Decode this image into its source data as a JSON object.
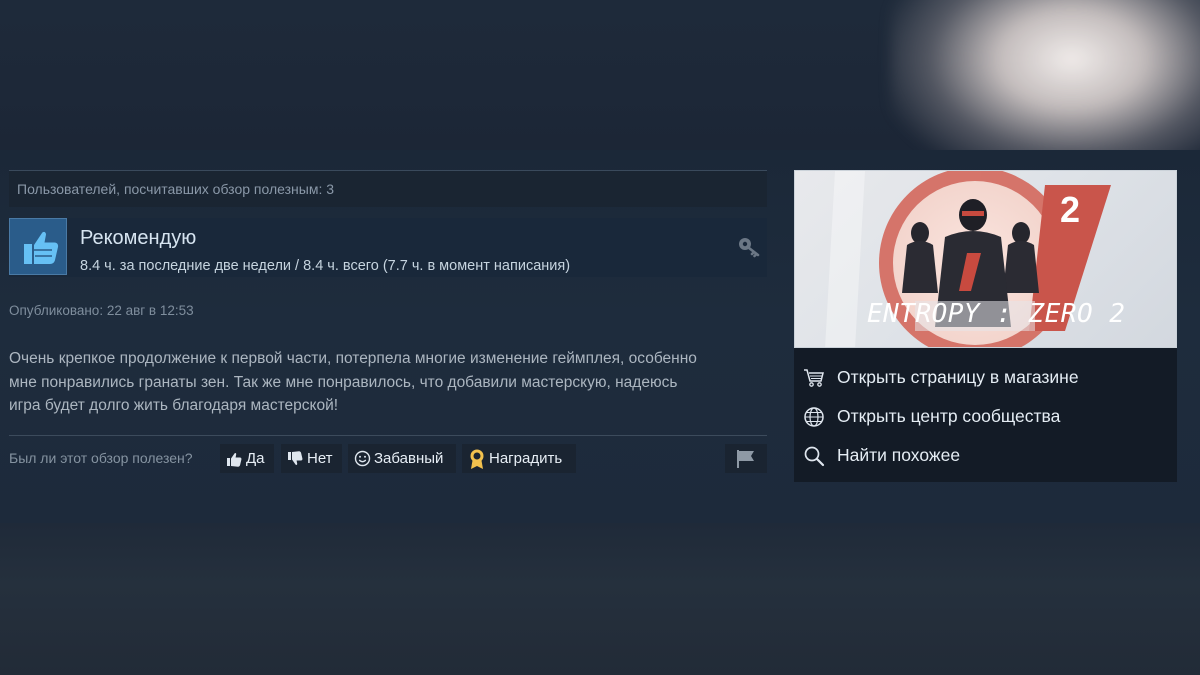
{
  "review": {
    "helpful_count_text": "Пользователей, посчитавших обзор полезным: 3",
    "verdict": "Рекомендую",
    "hours": "8.4 ч. за последние две недели / 8.4 ч. всего (7.7 ч. в момент написания)",
    "posted": "Опубликовано: 22 авг в 12:53",
    "body_lines": [
      "Очень крепкое продолжение к первой части, потерпела многие изменение геймплея, особенно",
      "мне понравились гранаты зен. Так же мне понравилось, что добавили мастерскую, надеюсь",
      "игра будет долго жить благодаря мастерской!"
    ]
  },
  "feedback": {
    "question": "Был ли этот обзор полезен?",
    "yes_label": "Да",
    "no_label": "Нет",
    "funny_label": "Забавный",
    "award_label": "Наградить"
  },
  "game": {
    "capsule_title": "ENTROPY : ZERO 2",
    "capsule_number": "2",
    "links": [
      {
        "label": "Открыть страницу в магазине",
        "icon": "cart-icon"
      },
      {
        "label": "Открыть центр сообщества",
        "icon": "globe-icon"
      },
      {
        "label": "Найти похожее",
        "icon": "search-icon"
      }
    ]
  },
  "colors": {
    "page_bg": "#1b2838",
    "accent_blue": "#2a5c8a",
    "text_light": "#d6e4f0",
    "text_muted": "#8a98a8",
    "award_gold": "#f2c14e"
  }
}
